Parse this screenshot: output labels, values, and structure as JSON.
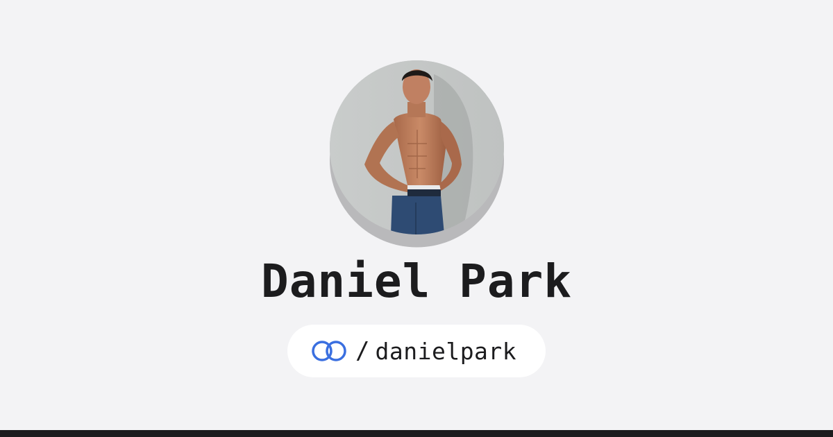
{
  "profile": {
    "name": "Daniel Park",
    "avatar_alt": "Profile photo"
  },
  "handle": {
    "icon": "link-rings-icon",
    "separator": "/",
    "username": "danielpark"
  },
  "colors": {
    "background": "#f3f3f5",
    "pill_background": "#ffffff",
    "text": "#1c1c1e",
    "icon_accent": "#3a6fe0",
    "bottom_bar": "#1c1c1e"
  }
}
